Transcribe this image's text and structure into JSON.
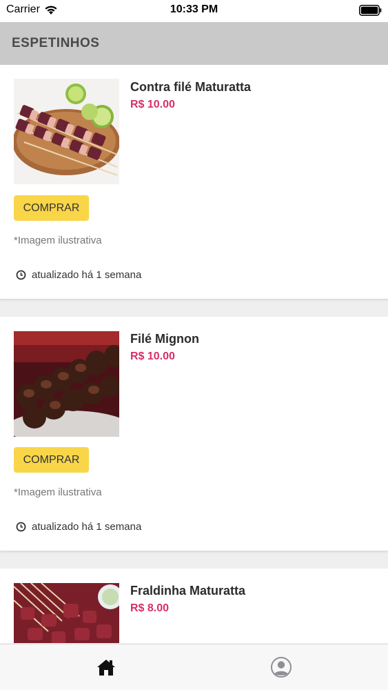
{
  "status_bar": {
    "carrier": "Carrier",
    "time": "10:33 PM"
  },
  "header": {
    "title": "ESPETINHOS"
  },
  "products": [
    {
      "name": "Contra filé Maturatta",
      "price": "R$ 10.00",
      "buy_label": "COMPRAR",
      "disclaimer": "*Imagem ilustrativa",
      "updated": "atualizado há 1 semana",
      "image": "skewers-on-board-with-lime"
    },
    {
      "name": "Filé Mignon",
      "price": "R$ 10.00",
      "buy_label": "COMPRAR",
      "disclaimer": "*Imagem ilustrativa",
      "updated": "atualizado há 1 semana",
      "image": "grilled-skewers-closeup"
    },
    {
      "name": "Fraldinha Maturatta",
      "price": "R$ 8.00",
      "image": "raw-meat-skewers"
    }
  ],
  "tab_bar": {
    "tabs": [
      {
        "icon": "home-icon",
        "active": true
      },
      {
        "icon": "profile-icon",
        "active": false
      }
    ]
  },
  "colors": {
    "price": "#d62f6a",
    "buy_button": "#f9d548",
    "header_bg": "#c9c9c9"
  }
}
